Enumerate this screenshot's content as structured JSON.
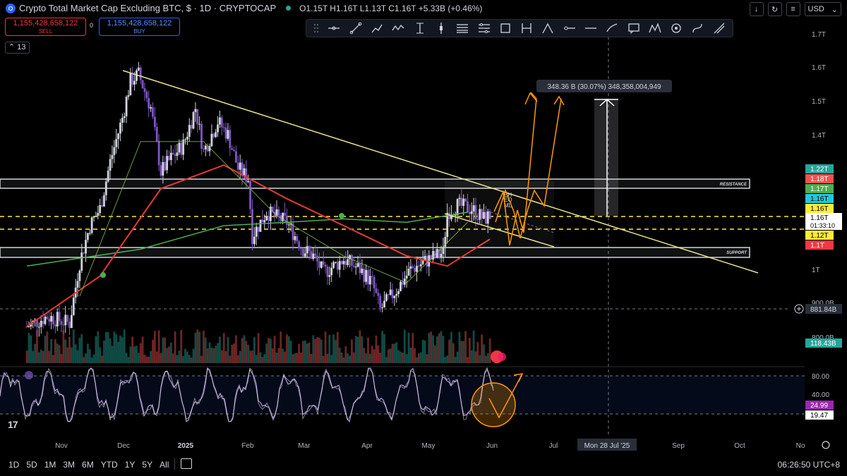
{
  "header": {
    "title": "Crypto Total Market Cap Excluding BTC, $ · 1D · CRYPTOCAP",
    "ohlc": "O1.15T  H1.16T  L1.13T  C1.16T  +5.33B (+0.46%)",
    "currency": "USD",
    "sell_value": "1,155,428,658,122",
    "sell_label": "SELL",
    "buy_value": "1,155,428,658,122",
    "buy_label": "BUY",
    "spread": "0",
    "indicator_count": "13"
  },
  "toolbar_icons": [
    "horizontal-line-icon",
    "trend-line-icon",
    "ray-icon",
    "path-icon",
    "polyline-icon",
    "cursor-icon",
    "long-position-icon",
    "parallel-channel-icon",
    "regression-icon",
    "rectangle-icon",
    "fork-icon",
    "triangle-icon",
    "horizontal-ray-icon",
    "arrow-line-icon",
    "brush-icon",
    "text-callout-icon",
    "pattern-icon",
    "ellipse-icon",
    "curve-icon",
    "measure-icon"
  ],
  "colors": {
    "background": "#000000",
    "up": "#d1d4dc",
    "down": "#7e57c2",
    "trendline": "#e8e38a",
    "zone": "#d1d4dc",
    "dashed": "#ffeb3b",
    "ma_red": "#e53935",
    "ma_green": "#4caf50",
    "projection": "#ff9800",
    "rsi": "#b39ddb"
  },
  "annotations": {
    "measure": "348.36 B (30.07%) 348,358,004,949",
    "resistance": "RESISTANCE",
    "support": "SUPPORT",
    "pattern_labels": [
      "EH",
      "EQ",
      "ML"
    ]
  },
  "chart_data": [
    {
      "type": "candlestick",
      "title": "Crypto Total Market Cap Excluding BTC, $ · 1D · CRYPTOCAP",
      "xlabel": "",
      "ylabel": "",
      "x_ticks": [
        "Nov",
        "Dec",
        "2025",
        "Feb",
        "Mar",
        "Apr",
        "May",
        "Jun",
        "Jul",
        "Sep",
        "Oct",
        "No"
      ],
      "crosshair_date": "Mon 28 Jul '25",
      "y_ticks": [
        "1.7T",
        "1.6T",
        "1.5T",
        "1.4T",
        "1T",
        "900.0B",
        "800.0B"
      ],
      "ylim": [
        0.78,
        1.73
      ],
      "series": [
        {
          "name": "close",
          "points": [
            [
              "2024-10-15",
              0.83
            ],
            [
              "2024-10-25",
              0.86
            ],
            [
              "2024-11-05",
              0.84
            ],
            [
              "2024-11-10",
              1.02
            ],
            [
              "2024-11-15",
              1.13
            ],
            [
              "2024-11-20",
              1.18
            ],
            [
              "2024-11-25",
              1.32
            ],
            [
              "2024-12-01",
              1.45
            ],
            [
              "2024-12-05",
              1.56
            ],
            [
              "2024-12-09",
              1.58
            ],
            [
              "2024-12-15",
              1.48
            ],
            [
              "2024-12-20",
              1.29
            ],
            [
              "2024-12-25",
              1.33
            ],
            [
              "2024-12-31",
              1.37
            ],
            [
              "2025-01-06",
              1.48
            ],
            [
              "2025-01-10",
              1.35
            ],
            [
              "2025-01-17",
              1.44
            ],
            [
              "2025-01-22",
              1.4
            ],
            [
              "2025-01-27",
              1.3
            ],
            [
              "2025-02-01",
              1.27
            ],
            [
              "2025-02-03",
              1.1
            ],
            [
              "2025-02-10",
              1.17
            ],
            [
              "2025-02-20",
              1.14
            ],
            [
              "2025-02-28",
              1.06
            ],
            [
              "2025-03-05",
              1.04
            ],
            [
              "2025-03-10",
              0.99
            ],
            [
              "2025-03-20",
              1.03
            ],
            [
              "2025-03-28",
              1.0
            ],
            [
              "2025-04-03",
              0.96
            ],
            [
              "2025-04-07",
              0.88
            ],
            [
              "2025-04-15",
              0.94
            ],
            [
              "2025-04-22",
              1.0
            ],
            [
              "2025-05-01",
              1.03
            ],
            [
              "2025-05-08",
              1.05
            ],
            [
              "2025-05-10",
              1.17
            ],
            [
              "2025-05-15",
              1.19
            ],
            [
              "2025-05-22",
              1.18
            ],
            [
              "2025-05-28",
              1.15
            ],
            [
              "2025-05-31",
              1.16
            ]
          ]
        },
        {
          "name": "MA fast",
          "points": [
            [
              "2024-11-10",
              0.92
            ],
            [
              "2024-12-10",
              1.38
            ],
            [
              "2025-01-10",
              1.38
            ],
            [
              "2025-02-15",
              1.16
            ],
            [
              "2025-03-20",
              1.04
            ],
            [
              "2025-04-20",
              0.96
            ],
            [
              "2025-05-20",
              1.14
            ]
          ]
        },
        {
          "name": "MA red",
          "points": [
            [
              "2024-10-15",
              0.83
            ],
            [
              "2024-11-20",
              0.98
            ],
            [
              "2024-12-20",
              1.24
            ],
            [
              "2025-01-20",
              1.31
            ],
            [
              "2025-02-20",
              1.21
            ],
            [
              "2025-03-20",
              1.13
            ],
            [
              "2025-04-20",
              1.04
            ],
            [
              "2025-05-10",
              1.01
            ],
            [
              "2025-05-31",
              1.09
            ]
          ]
        },
        {
          "name": "MA green",
          "points": [
            [
              "2024-10-15",
              1.01
            ],
            [
              "2024-12-10",
              1.06
            ],
            [
              "2025-01-20",
              1.13
            ],
            [
              "2025-02-20",
              1.14
            ],
            [
              "2025-03-20",
              1.15
            ],
            [
              "2025-04-20",
              1.14
            ],
            [
              "2025-05-20",
              1.17
            ]
          ]
        }
      ],
      "price_labels": [
        "1.22T",
        "1.18T",
        "1.17T",
        "1.16T",
        "1.16T",
        "1.12T",
        "1.1T"
      ],
      "last_price": "1.16T",
      "countdown": "01:33:10",
      "crosshair_price": "881.84B",
      "volume_label": "118.43B"
    },
    {
      "type": "line",
      "title": "",
      "y_ticks": [
        "80.00",
        "40.00"
      ],
      "ylim": [
        0,
        100
      ],
      "levels": [
        80,
        20
      ],
      "values_labels": [
        "24.99",
        "19.47"
      ]
    }
  ],
  "footer": {
    "ranges": [
      "1D",
      "5D",
      "1M",
      "3M",
      "6M",
      "YTD",
      "1Y",
      "5Y",
      "All"
    ],
    "clock": "06:26:50 UTC+8"
  }
}
